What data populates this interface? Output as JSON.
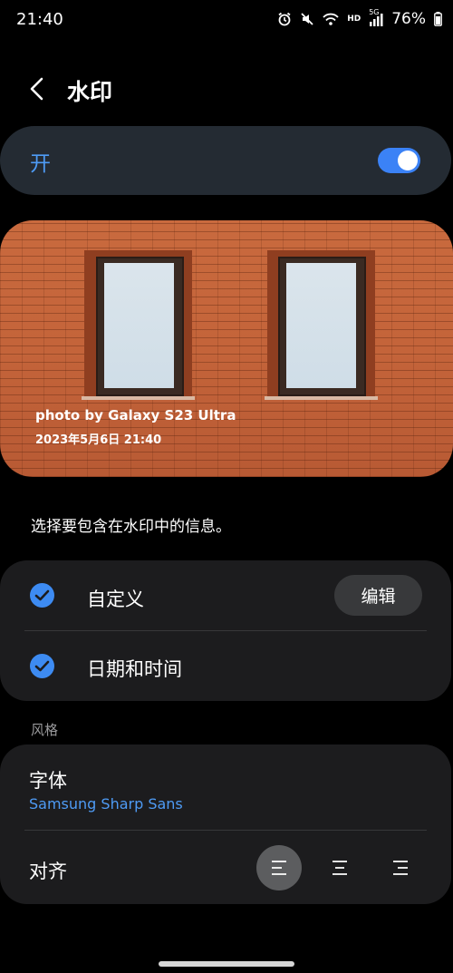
{
  "status_bar": {
    "time": "21:40",
    "network_label": "HD",
    "network_gen": "5G",
    "battery": "76%"
  },
  "header": {
    "title": "水印",
    "back_icon": "chevron-left-icon"
  },
  "master_switch": {
    "label": "开",
    "enabled": true,
    "accent": "#3b82f6"
  },
  "preview": {
    "watermark_line1": "photo by Galaxy S23 Ultra",
    "watermark_line2": "2023年5月6日 21:40"
  },
  "info_prompt": "选择要包含在水印中的信息。",
  "info_options": [
    {
      "label": "自定义",
      "checked": true,
      "action_label": "编辑"
    },
    {
      "label": "日期和时间",
      "checked": true
    }
  ],
  "style_section": {
    "title": "风格",
    "font_label": "字体",
    "font_value": "Samsung Sharp Sans",
    "align_label": "对齐",
    "align_options": [
      "align-left-icon",
      "align-center-icon",
      "align-right-icon"
    ],
    "align_selected": "align-left-icon"
  }
}
